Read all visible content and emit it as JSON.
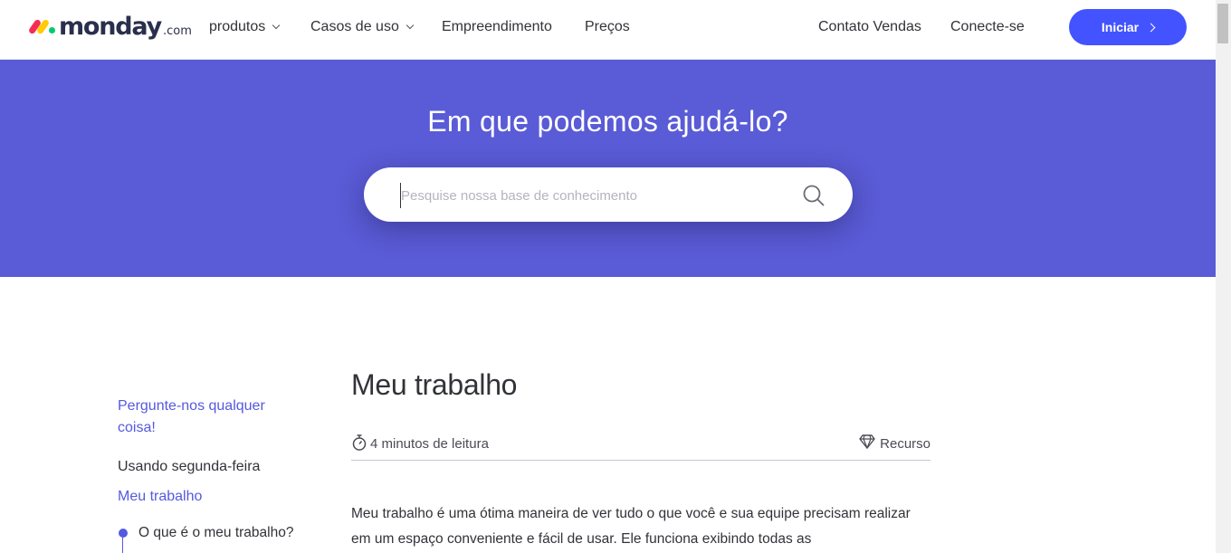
{
  "logo": {
    "text": "monday",
    "suffix": ".com"
  },
  "nav": {
    "items": [
      {
        "label": "produtos",
        "dropdown": true
      },
      {
        "label": "Casos de uso",
        "dropdown": true
      },
      {
        "label": "Empreendimento",
        "dropdown": false
      },
      {
        "label": "Preços",
        "dropdown": false
      }
    ],
    "right": [
      {
        "label": "Contato Vendas"
      },
      {
        "label": "Conecte-se"
      }
    ],
    "cta_label": "Iniciar"
  },
  "hero": {
    "title": "Em que podemos ajudá-lo?",
    "search_placeholder": "Pesquise nossa base de conhecimento",
    "search_value": ""
  },
  "sidebar": {
    "ask": "Pergunte-nos qualquer coisa!",
    "section": "Usando segunda-feira",
    "current": "Meu trabalho",
    "toc": [
      "O que é o meu trabalho?"
    ]
  },
  "article": {
    "title": "Meu trabalho",
    "read_time": "4 minutos de leitura",
    "resource_label": "Recurso",
    "paragraph": "Meu trabalho é uma ótima maneira de ver tudo o que você e sua equipe precisam realizar em um espaço conveniente e fácil de usar. Ele funciona exibindo todas as"
  },
  "colors": {
    "hero_bg": "#5a5bd6",
    "cta_bg": "#4353ff",
    "link": "#5559df"
  }
}
